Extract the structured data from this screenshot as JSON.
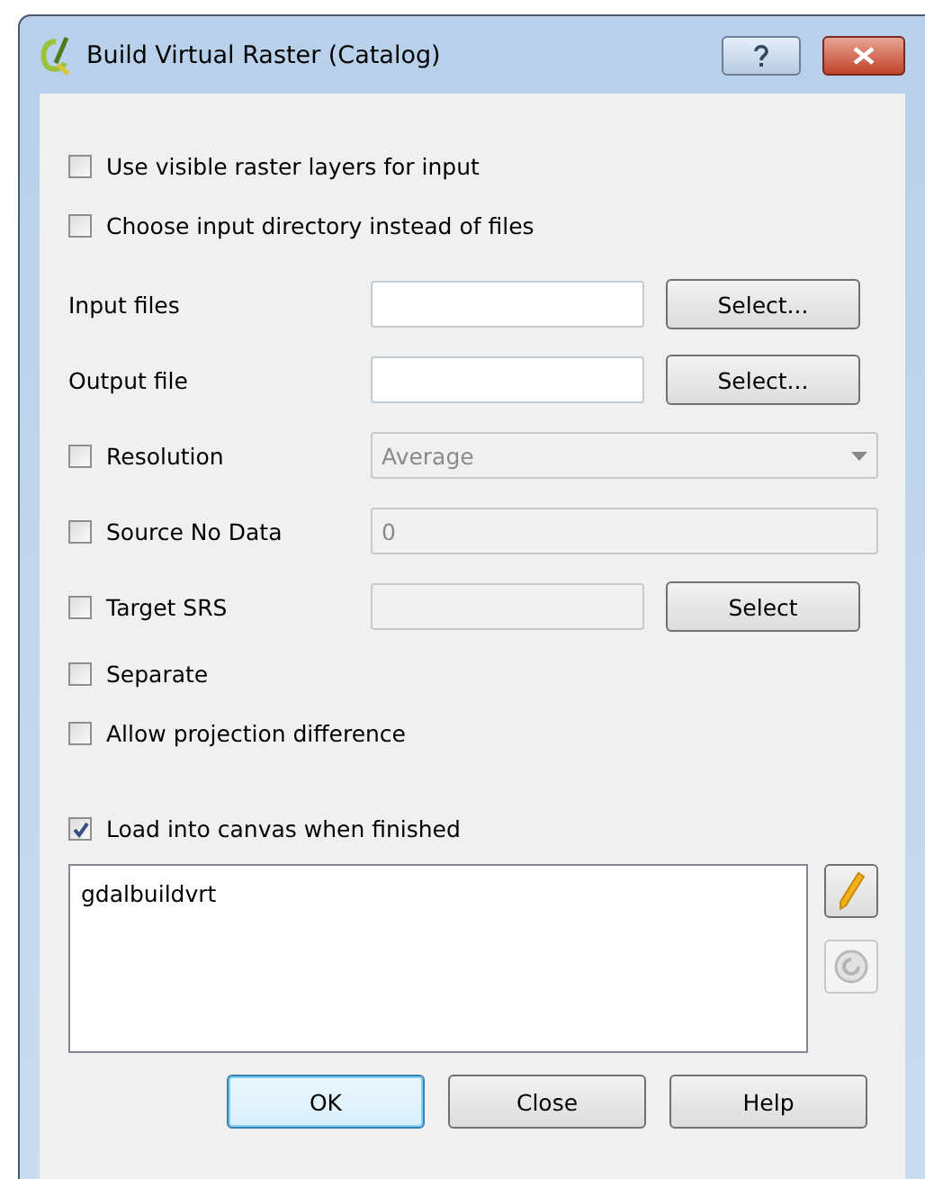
{
  "window": {
    "title": "Build Virtual Raster (Catalog)"
  },
  "top_options": [
    {
      "label": "Use visible raster layers for input",
      "checked": false
    },
    {
      "label": "Choose input directory instead of files",
      "checked": false
    }
  ],
  "rows": [
    {
      "kind": "file",
      "label": "Input files",
      "button": "Select..."
    },
    {
      "kind": "file",
      "label": "Output file",
      "button": "Select..."
    },
    {
      "kind": "combo",
      "label": "Resolution",
      "checked": false,
      "value": "Average",
      "disabled": true
    },
    {
      "kind": "text",
      "label": "Source No Data",
      "checked": false,
      "value": "0",
      "disabled": true
    },
    {
      "kind": "srs",
      "label": "Target SRS",
      "checked": false,
      "disabled": true,
      "button": "Select"
    }
  ],
  "bottom_options": [
    {
      "label": "Separate",
      "checked": false
    },
    {
      "label": "Allow projection difference",
      "checked": false
    }
  ],
  "load_option": {
    "label": "Load into canvas when finished",
    "checked": true
  },
  "command": {
    "value": "gdalbuildvrt"
  },
  "side_buttons": [
    {
      "kind": "edit",
      "disabled": false
    },
    {
      "kind": "reset",
      "disabled": true
    }
  ],
  "buttons": [
    {
      "label": "OK",
      "focused": true
    },
    {
      "label": "Close",
      "focused": false
    },
    {
      "label": "Help",
      "focused": false
    }
  ]
}
